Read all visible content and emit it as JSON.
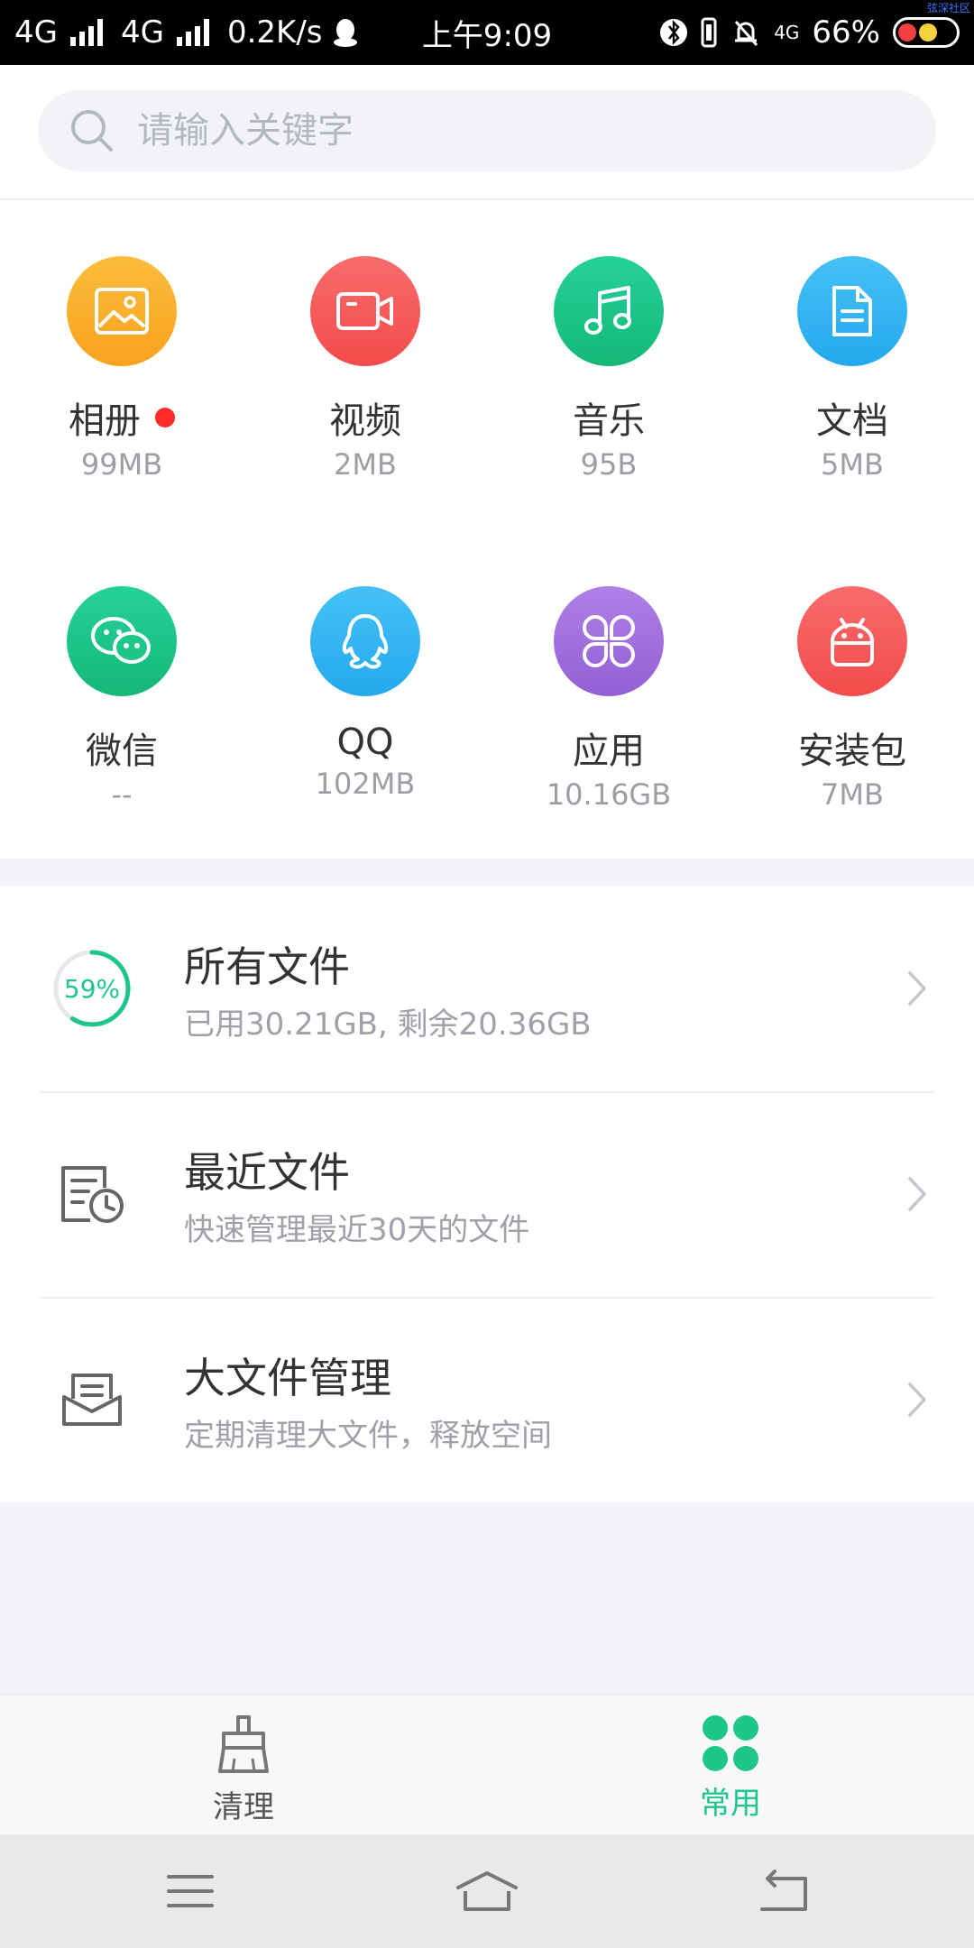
{
  "status_bar": {
    "net1": "4G",
    "net2": "4G",
    "speed": "0.2K/s",
    "time": "上午9:09",
    "net_small": "4G",
    "battery_percent": "66%",
    "watermark": "弦深社区"
  },
  "search": {
    "placeholder": "请输入关键字"
  },
  "categories": [
    {
      "label": "相册",
      "size": "99MB",
      "icon": "image-icon",
      "color": "#fbac2c",
      "badge": true
    },
    {
      "label": "视频",
      "size": "2MB",
      "icon": "video-camera-icon",
      "color": "#f65a5a",
      "badge": false
    },
    {
      "label": "音乐",
      "size": "95B",
      "icon": "music-note-icon",
      "color": "#1ec68a",
      "badge": false
    },
    {
      "label": "文档",
      "size": "5MB",
      "icon": "document-icon",
      "color": "#33b5f3",
      "badge": false
    },
    {
      "label": "微信",
      "size": "--",
      "icon": "wechat-icon",
      "color": "#1ec68a",
      "badge": false
    },
    {
      "label": "QQ",
      "size": "102MB",
      "icon": "qq-penguin-icon",
      "color": "#33b5f3",
      "badge": false
    },
    {
      "label": "应用",
      "size": "10.16GB",
      "icon": "apps-grid-icon",
      "color": "#9f6fdc",
      "badge": false
    },
    {
      "label": "安装包",
      "size": "7MB",
      "icon": "android-icon",
      "color": "#f65a5a",
      "badge": false
    }
  ],
  "list": {
    "all_files": {
      "title": "所有文件",
      "sub": "已用30.21GB, 剩余20.36GB",
      "percent_label": "59%",
      "percent": 0.59
    },
    "recent": {
      "title": "最近文件",
      "sub": "快速管理最近30天的文件"
    },
    "large": {
      "title": "大文件管理",
      "sub": "定期清理大文件，释放空间"
    }
  },
  "bottom_nav": {
    "clean": "清理",
    "common": "常用"
  },
  "colors": {
    "accent": "#1ec68a",
    "inactive": "#555555"
  }
}
